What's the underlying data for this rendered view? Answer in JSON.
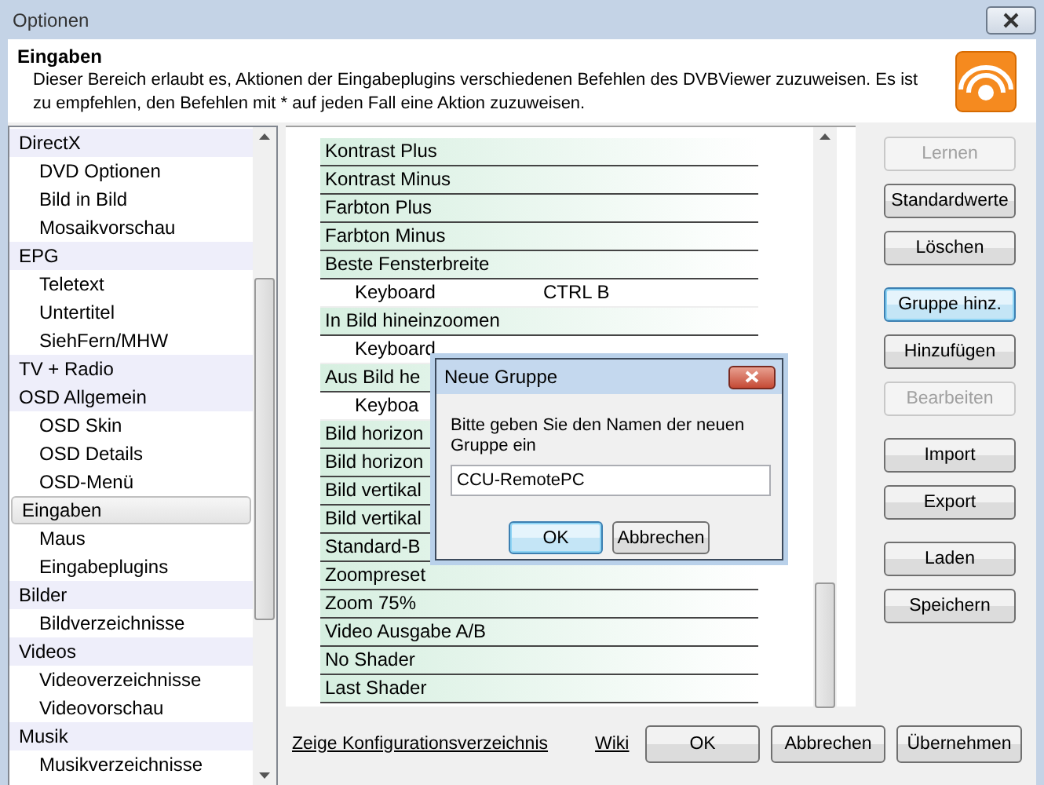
{
  "window": {
    "title": "Optionen"
  },
  "header": {
    "title": "Eingaben",
    "text": "Dieser Bereich erlaubt es, Aktionen der Eingabeplugins verschiedenen Befehlen des DVBViewer zuzuweisen. Es ist zu empfehlen, den Befehlen mit * auf jeden Fall eine Aktion zuzuweisen."
  },
  "sidebar": {
    "items": [
      {
        "label": "DirectX",
        "selected": false,
        "children": [
          {
            "label": "DVD Optionen",
            "selected": false
          },
          {
            "label": "Bild in Bild",
            "selected": false
          },
          {
            "label": "Mosaikvorschau",
            "selected": false
          }
        ]
      },
      {
        "label": "EPG",
        "selected": false,
        "children": [
          {
            "label": "Teletext",
            "selected": false
          },
          {
            "label": "Untertitel",
            "selected": false
          },
          {
            "label": "SiehFern/MHW",
            "selected": false
          }
        ]
      },
      {
        "label": "TV + Radio",
        "selected": false
      },
      {
        "label": "OSD Allgemein",
        "selected": false,
        "children": [
          {
            "label": "OSD Skin",
            "selected": false
          },
          {
            "label": "OSD Details",
            "selected": false
          },
          {
            "label": "OSD-Menü",
            "selected": false
          }
        ]
      },
      {
        "label": "Eingaben",
        "selected": true,
        "children": [
          {
            "label": "Maus",
            "selected": false
          },
          {
            "label": "Eingabeplugins",
            "selected": false
          }
        ]
      },
      {
        "label": "Bilder",
        "selected": false,
        "children": [
          {
            "label": "Bildverzeichnisse",
            "selected": false
          }
        ]
      },
      {
        "label": "Videos",
        "selected": false,
        "children": [
          {
            "label": "Videoverzeichnisse",
            "selected": false
          },
          {
            "label": "Videovorschau",
            "selected": false
          }
        ]
      },
      {
        "label": "Musik",
        "selected": false,
        "children": [
          {
            "label": "Musikverzeichnisse",
            "selected": false
          }
        ]
      }
    ]
  },
  "commands": [
    {
      "label": "Kontrast Plus"
    },
    {
      "label": "Kontrast Minus"
    },
    {
      "label": "Farbton Plus"
    },
    {
      "label": "Farbton Minus"
    },
    {
      "label": "Beste Fensterbreite",
      "children": [
        {
          "label": "Keyboard",
          "value": "CTRL B"
        }
      ]
    },
    {
      "label": "In Bild hineinzoomen",
      "children": [
        {
          "label": "Keyboard"
        }
      ]
    },
    {
      "label": "Aus Bild he",
      "children": [
        {
          "label": "Keyboa"
        }
      ]
    },
    {
      "label": "Bild horizon"
    },
    {
      "label": "Bild horizon"
    },
    {
      "label": "Bild vertikal"
    },
    {
      "label": "Bild vertikal"
    },
    {
      "label": "Standard-B"
    },
    {
      "label": "Zoompreset"
    },
    {
      "label": "Zoom 75%"
    },
    {
      "label": "Video Ausgabe A/B"
    },
    {
      "label": "No Shader"
    },
    {
      "label": "Last Shader"
    }
  ],
  "side_buttons": [
    [
      {
        "label": "Lernen",
        "disabled": true,
        "focused": false
      },
      {
        "label": "Standardwerte",
        "disabled": false,
        "focused": false
      },
      {
        "label": "Löschen",
        "disabled": false,
        "focused": false
      }
    ],
    [
      {
        "label": "Gruppe hinz.",
        "disabled": false,
        "focused": true
      },
      {
        "label": "Hinzufügen",
        "disabled": false,
        "focused": false
      },
      {
        "label": "Bearbeiten",
        "disabled": true,
        "focused": false
      }
    ],
    [
      {
        "label": "Import",
        "disabled": false,
        "focused": false
      },
      {
        "label": "Export",
        "disabled": false,
        "focused": false
      }
    ],
    [
      {
        "label": "Laden",
        "disabled": false,
        "focused": false
      },
      {
        "label": "Speichern",
        "disabled": false,
        "focused": false
      }
    ]
  ],
  "dialog": {
    "title": "Neue Gruppe",
    "prompt": "Bitte geben Sie den Namen der neuen Gruppe ein",
    "value": "CCU-RemotePC",
    "buttons": [
      {
        "label": "OK",
        "focused": true
      },
      {
        "label": "Abbrechen",
        "focused": false
      }
    ]
  },
  "footer": {
    "links": [
      "Zeige Konfigurationsverzeichnis",
      "Wiki"
    ],
    "buttons": [
      "OK",
      "Abbrechen",
      "Übernehmen"
    ]
  }
}
